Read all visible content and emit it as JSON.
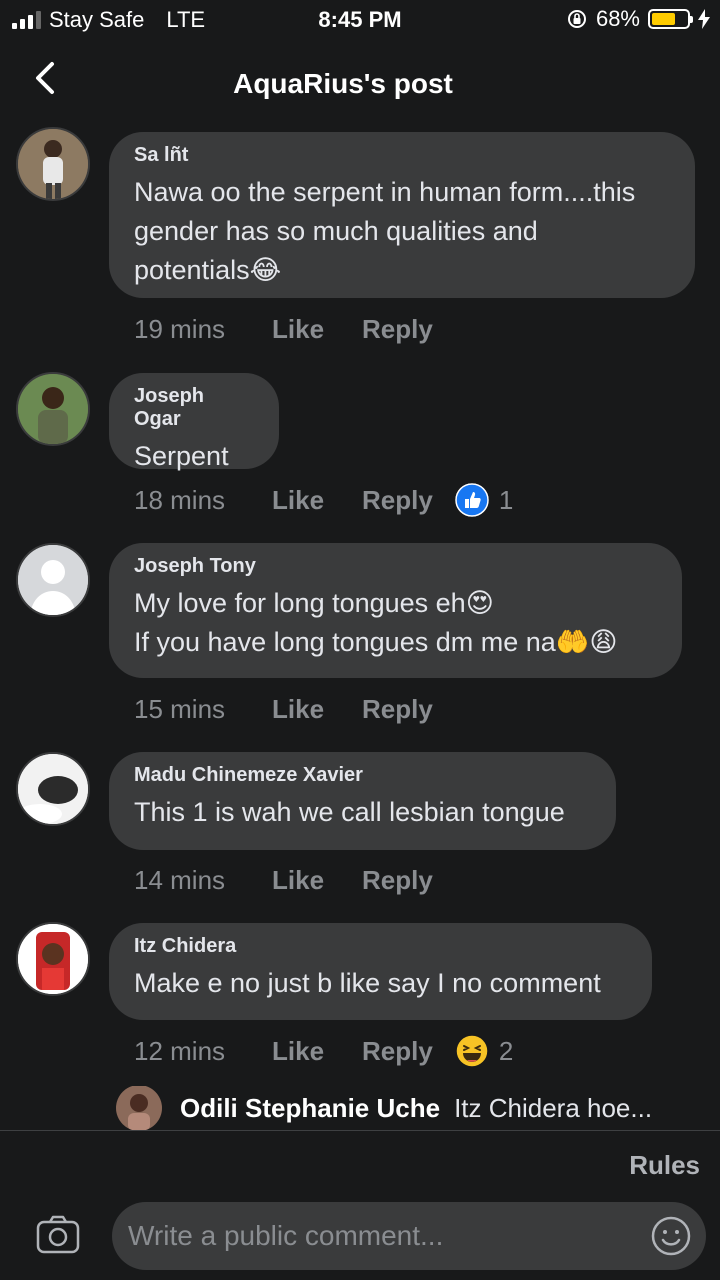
{
  "status_bar": {
    "carrier": "Stay Safe",
    "network": "LTE",
    "time": "8:45 PM",
    "battery": "68%",
    "battery_level": 0.68
  },
  "header": {
    "title": "AquaRius's post"
  },
  "comments": [
    {
      "author": "Sa lñt",
      "text": "Nawa oo the serpent in human form....this\ngender has so much qualities and\npotentials😂",
      "time": "19 mins",
      "like": "Like",
      "reply": "Reply"
    },
    {
      "author": "Joseph Ogar",
      "text": "Serpent",
      "time": "18 mins",
      "like": "Like",
      "reply": "Reply",
      "reaction": {
        "icon": "like-reaction-icon",
        "count": "1"
      }
    },
    {
      "author": "Joseph Tony",
      "text": "My love for long tongues eh😍\nIf you have long tongues dm me na🤲😩",
      "time": "15 mins",
      "like": "Like",
      "reply": "Reply"
    },
    {
      "author": "Madu Chinemeze Xavier",
      "text": "This 1 is wah we call lesbian tongue",
      "time": "14 mins",
      "like": "Like",
      "reply": "Reply"
    },
    {
      "author": "Itz Chidera",
      "text": "Make e no just b like say I no comment",
      "time": "12 mins",
      "like": "Like",
      "reply": "Reply",
      "reaction": {
        "icon": "haha-reaction-icon",
        "count": "2"
      }
    }
  ],
  "reply_preview": {
    "author": "Odili Stephanie Uche",
    "text": "Itz Chidera hoe..."
  },
  "footer": {
    "rules": "Rules",
    "placeholder": "Write a public comment..."
  },
  "colors": {
    "background": "#18191a",
    "bubble": "#3a3b3c",
    "battery": "#ffcc00",
    "like_blue": "#1877f2"
  }
}
